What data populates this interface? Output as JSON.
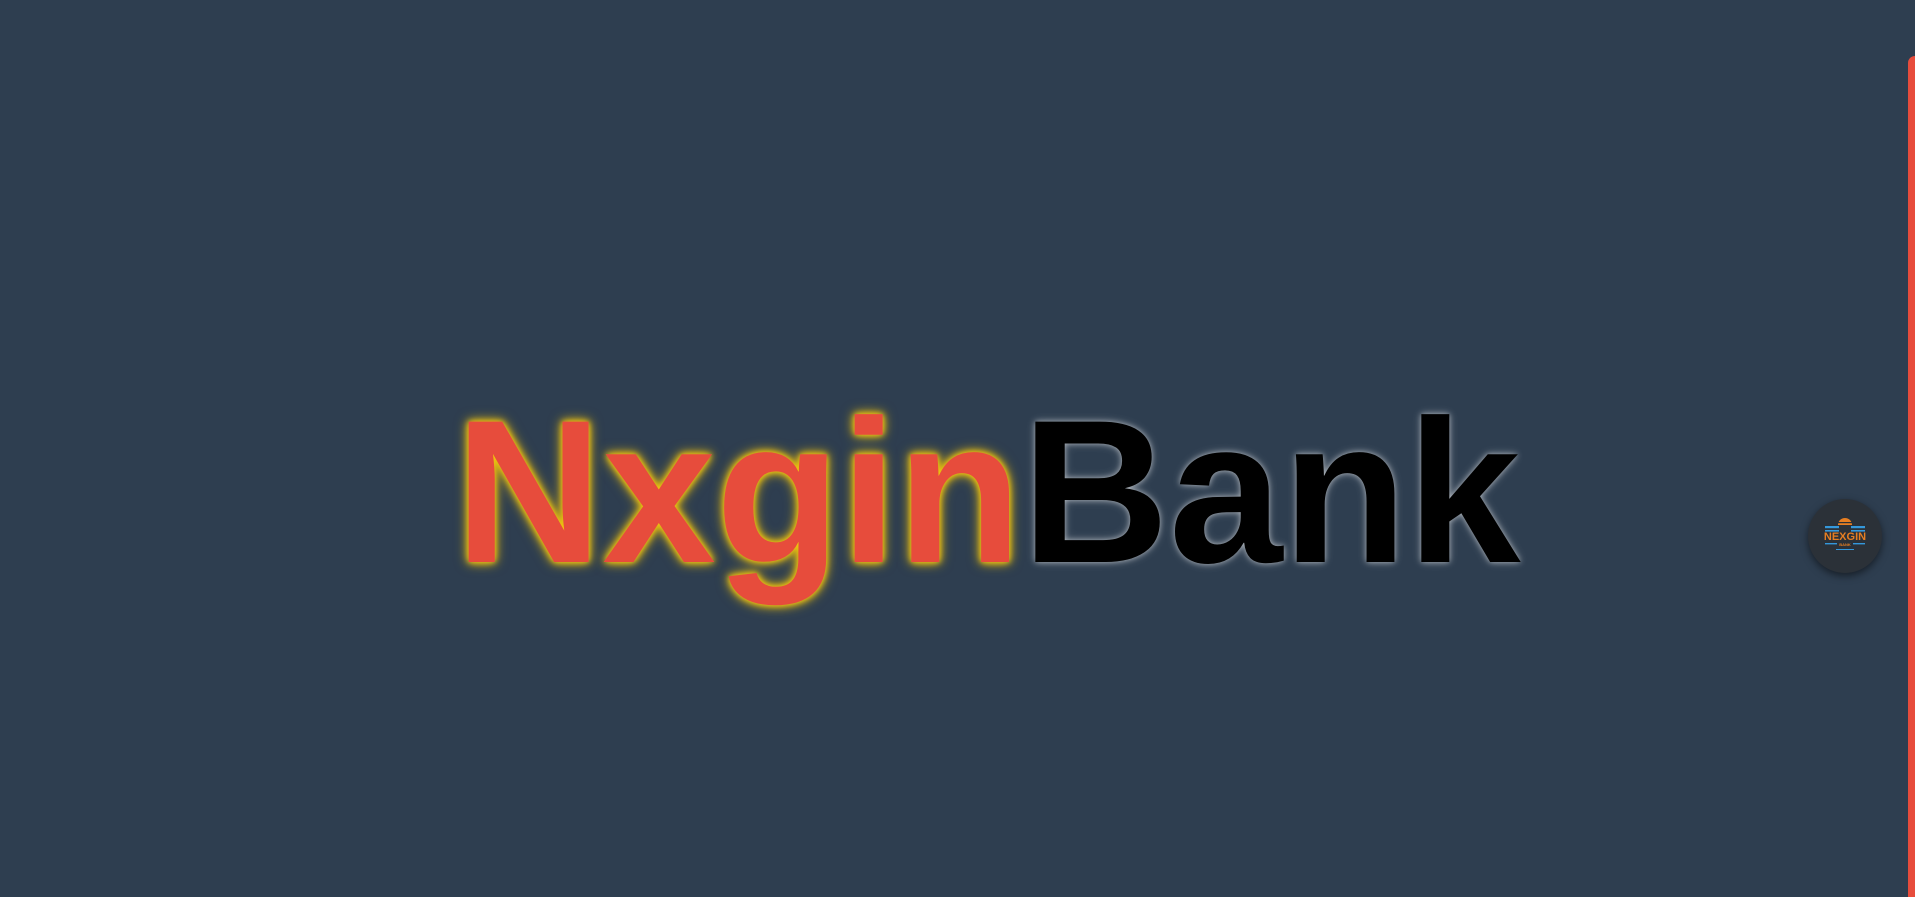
{
  "brand": {
    "name_part_1": "Nxgin",
    "name_part_2": "Bank"
  },
  "logo_badge": {
    "title": "NEXGIN",
    "subtitle": "BANK",
    "icon": "bank-logo-icon"
  },
  "colors": {
    "background": "#2e3e50",
    "brand_accent": "#e74c3c",
    "glow": "#f1c40f",
    "secondary_text": "#000000",
    "logo_blue": "#3498db",
    "logo_orange": "#e67e22"
  }
}
